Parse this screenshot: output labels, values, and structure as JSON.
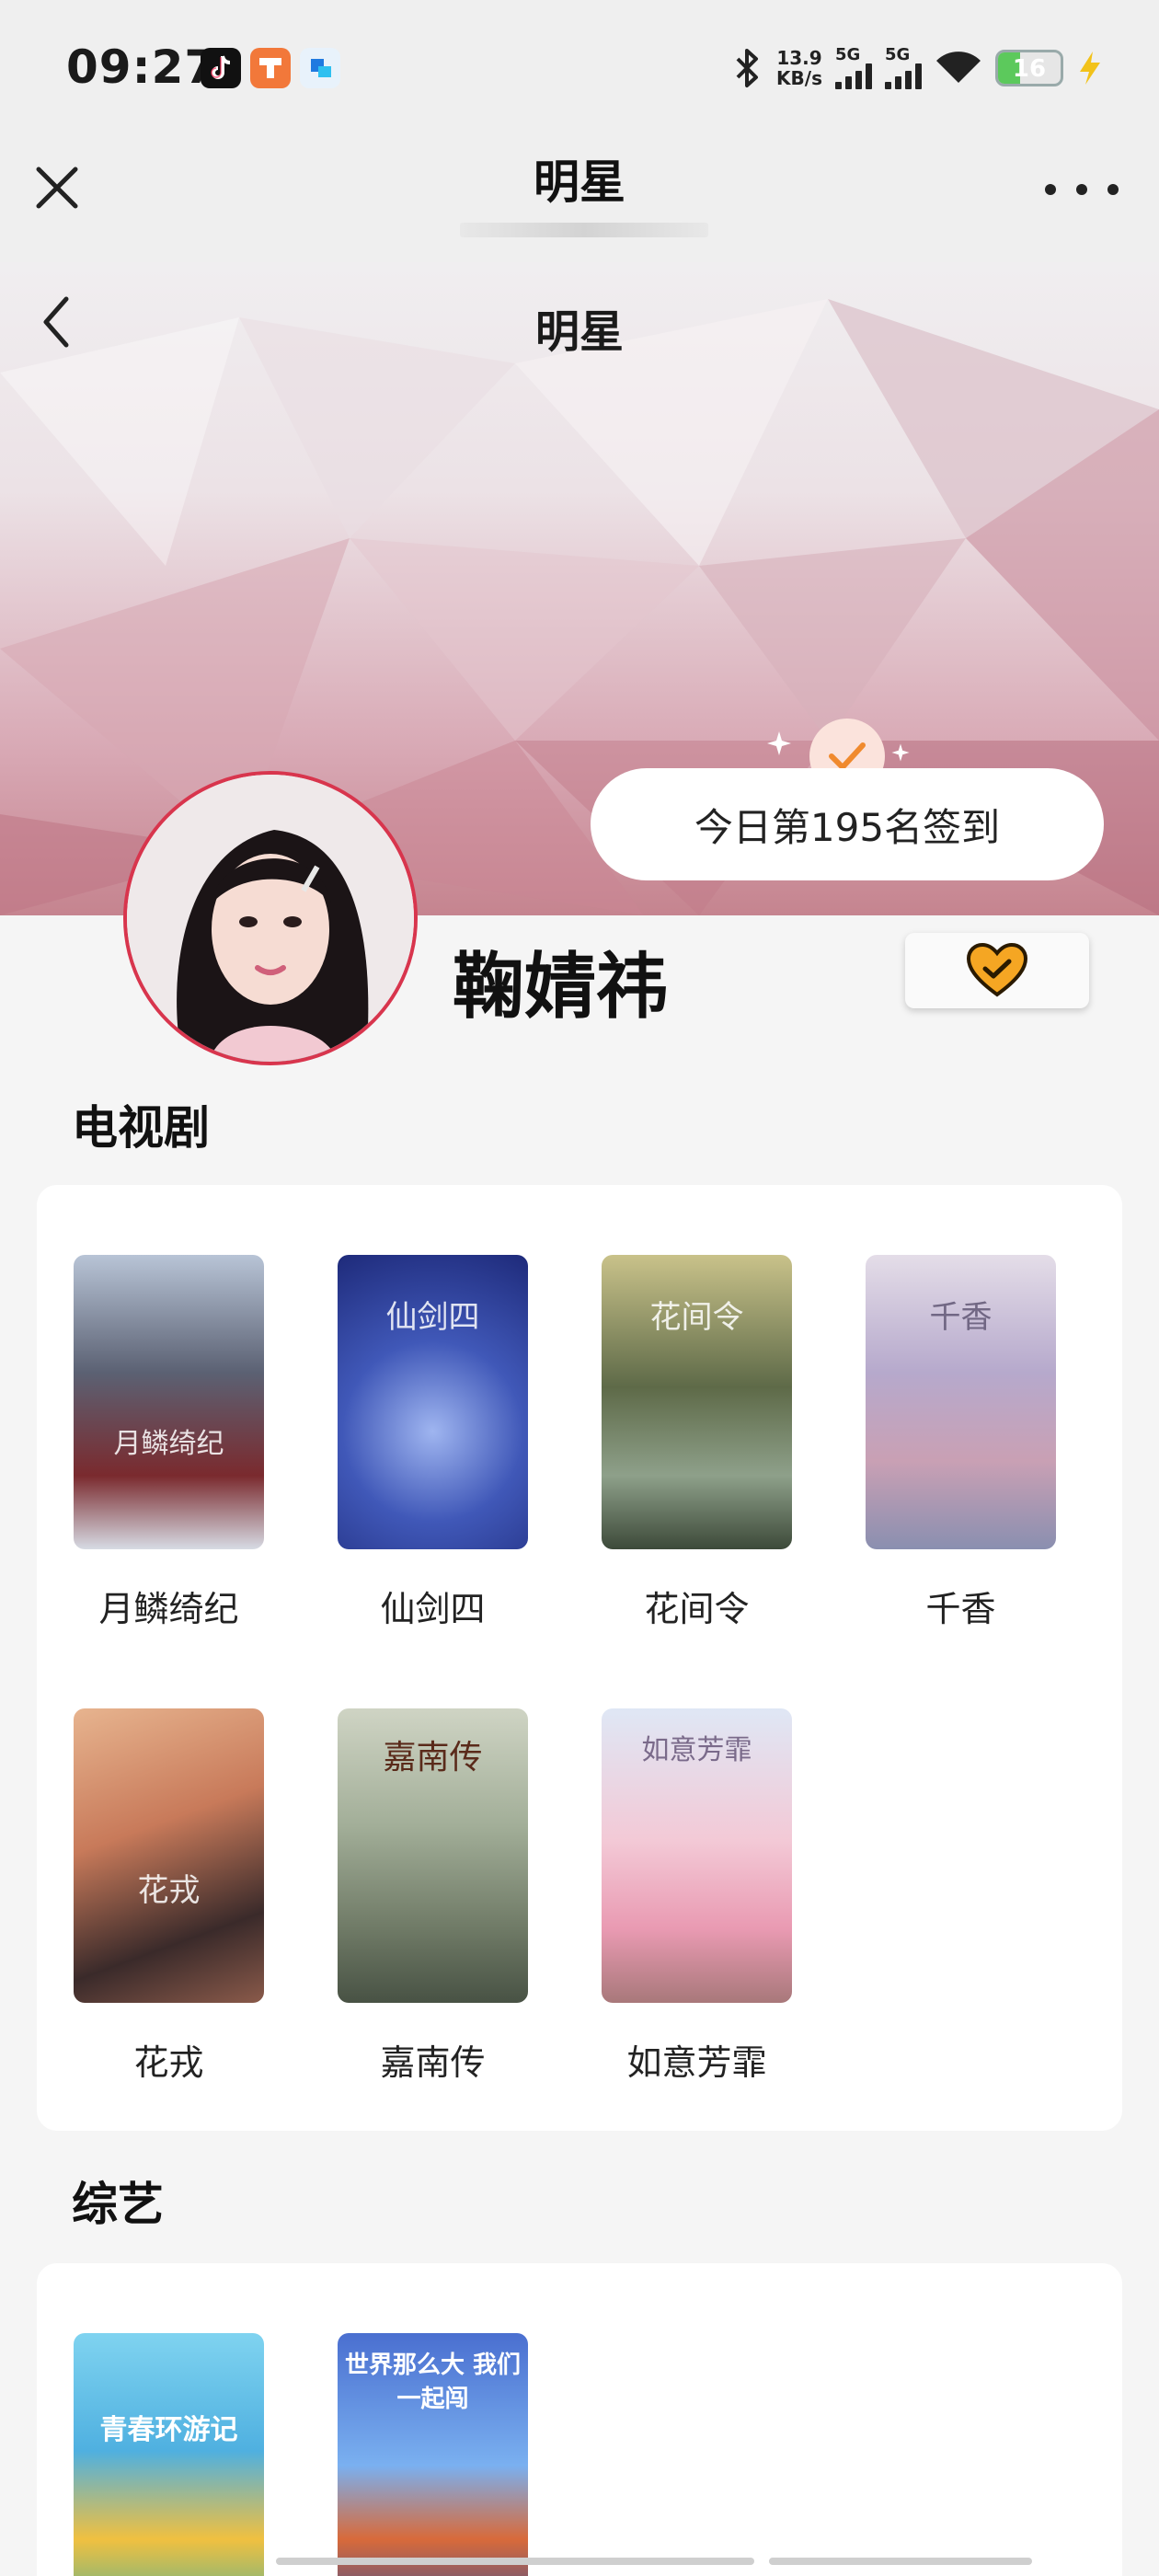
{
  "status_bar": {
    "time": "09:27",
    "net_speed_value": "13.9",
    "net_speed_unit": "KB/s",
    "signal1_label": "5G",
    "signal2_label": "5G",
    "battery_level": "16",
    "battery_fraction": 0.16,
    "app_icons": [
      "tiktok-icon",
      "orange-app-icon",
      "blue-app-icon"
    ]
  },
  "nav": {
    "title": "明星"
  },
  "banner": {
    "title": "明星",
    "checkin_text": "今日第195名签到"
  },
  "profile": {
    "name": "鞠婧祎",
    "follow_color": "#f5a623"
  },
  "tv_section": {
    "title": "电视剧",
    "items": [
      {
        "title": "月鳞绮纪",
        "poster_text": "月鳞绮纪"
      },
      {
        "title": "仙剑四",
        "poster_text": "仙剑四"
      },
      {
        "title": "花间令",
        "poster_text": "花间令"
      },
      {
        "title": "千香",
        "poster_text": "千香"
      },
      {
        "title": "花戎",
        "poster_text": "花戎"
      },
      {
        "title": "嘉南传",
        "poster_text": "嘉南传"
      },
      {
        "title": "如意芳霏",
        "poster_text": "如意芳霏"
      }
    ]
  },
  "variety_section": {
    "title": "综艺",
    "items": [
      {
        "poster_text": "青春环游记"
      },
      {
        "poster_text": "世界那么大 我们一起闯"
      }
    ]
  },
  "colors": {
    "accent": "#f08a2e",
    "avatar_ring": "#d8354d",
    "banner_pink": "#c5848f"
  }
}
